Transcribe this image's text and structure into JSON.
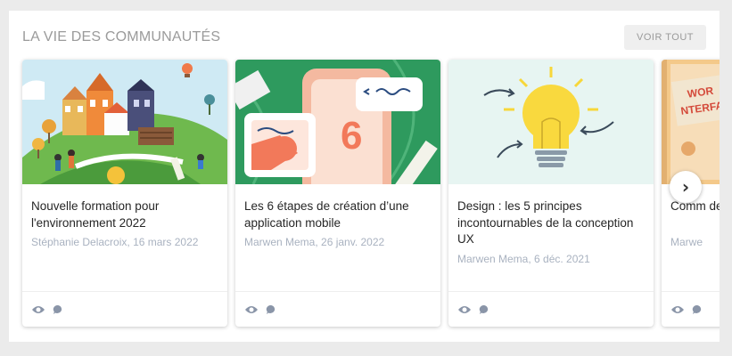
{
  "section": {
    "title": "LA VIE DES COMMUNAUTÉS",
    "view_all_label": "VOIR TOUT"
  },
  "cards": [
    {
      "title": "Nouvelle formation pour l'environnement 2022",
      "meta": "Stéphanie Delacroix, 16 mars 2022",
      "image": "village-illustration"
    },
    {
      "title": "Les 6 étapes de création d’une application mobile",
      "meta": "Marwen Mema, 26 janv. 2022",
      "image": "mobile-app-illustration"
    },
    {
      "title": "Design : les 5 principes incontournables de la conception UX",
      "meta": "Marwen Mema, 6 déc. 2021",
      "image": "lightbulb-illustration"
    },
    {
      "title": "Comm de sor",
      "meta": "Marwe",
      "image": "book-illustration",
      "thumb_text_1": "WOR",
      "thumb_text_2": "NTERFAC"
    }
  ],
  "icons": {
    "views": "eye-icon",
    "comments": "comment-icon",
    "next": "chevron-right-icon"
  },
  "carousel": {
    "next_label": "›"
  },
  "colors": {
    "title": "#9b9b9b",
    "meta": "#a9b2c0",
    "green": "#2e9a5e",
    "orange": "#f2795a",
    "yellow": "#f7d73a"
  }
}
